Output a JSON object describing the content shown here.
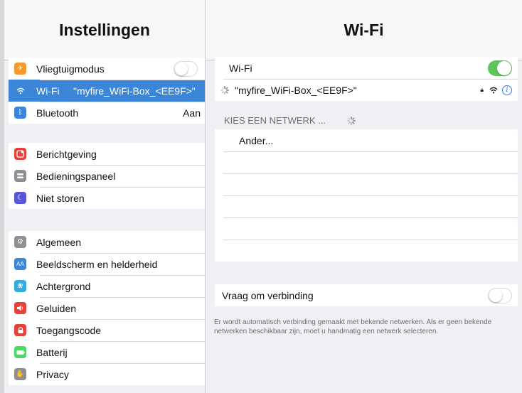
{
  "left": {
    "title": "Instellingen",
    "groups": [
      [
        {
          "label": "Vliegtuigmodus",
          "icon": "airplane-icon",
          "color": "#f59a2f",
          "toggle": "off"
        },
        {
          "label": "Wi-Fi",
          "value": "\"myfire_WiFi-Box_<EE9F>\"",
          "icon": "wifi-icon",
          "color": "#3b86d8",
          "selected": true
        },
        {
          "label": "Bluetooth",
          "value": "Aan",
          "icon": "bluetooth-icon",
          "color": "#3b86d8"
        }
      ],
      [
        {
          "label": "Berichtgeving",
          "icon": "notifications-icon",
          "color": "#e7413a"
        },
        {
          "label": "Bedieningspaneel",
          "icon": "control-center-icon",
          "color": "#8e8e93"
        },
        {
          "label": "Niet storen",
          "icon": "moon-icon",
          "color": "#5856d6"
        }
      ],
      [
        {
          "label": "Algemeen",
          "icon": "gear-icon",
          "color": "#8e8e93"
        },
        {
          "label": "Beeldscherm en helderheid",
          "icon": "display-icon",
          "color": "#3b86d8"
        },
        {
          "label": "Achtergrond",
          "icon": "wallpaper-icon",
          "color": "#35aadc"
        },
        {
          "label": "Geluiden",
          "icon": "speaker-icon",
          "color": "#e7413a"
        },
        {
          "label": "Toegangscode",
          "icon": "lock-icon",
          "color": "#e7413a"
        },
        {
          "label": "Batterij",
          "icon": "battery-icon",
          "color": "#4cd964"
        },
        {
          "label": "Privacy",
          "icon": "hand-icon",
          "color": "#8e8e93"
        }
      ]
    ]
  },
  "right": {
    "title": "Wi-Fi",
    "wifi_label": "Wi-Fi",
    "wifi_toggle": "on",
    "connected_network": "\"myfire_WiFi-Box_<EE9F>\"",
    "choose_header": "KIES EEN NETWERK ...",
    "other_label": "Ander...",
    "ask_label": "Vraag om verbinding",
    "ask_toggle": "off",
    "footer": "Er wordt automatisch verbinding gemaakt met bekende netwerken. Als er geen bekende netwerken beschikbaar zijn, moet u handmatig een netwerk selecteren."
  },
  "colors": {
    "accent": "#3b86d8",
    "toggle_on": "#5fc65b",
    "info": "#3478f6"
  }
}
